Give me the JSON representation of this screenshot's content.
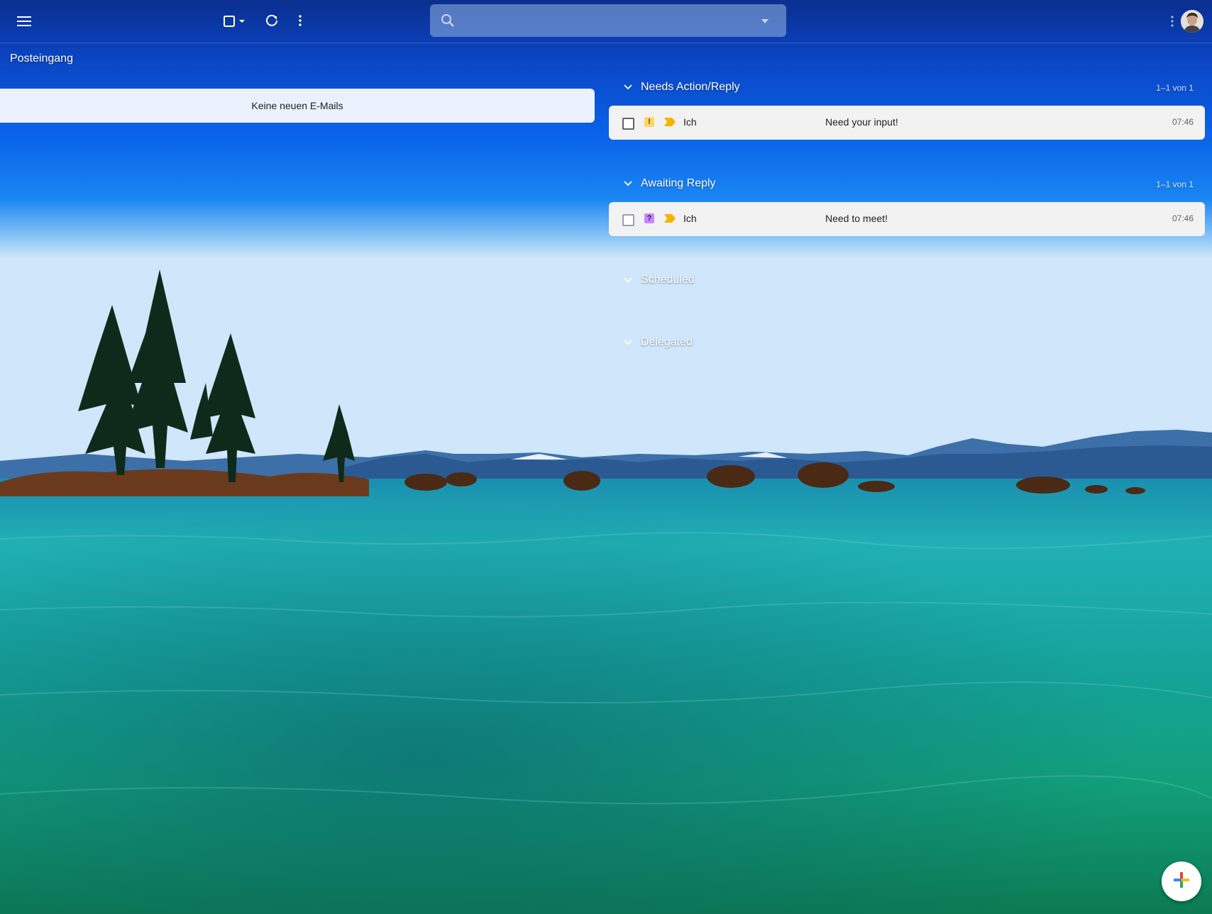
{
  "colors": {
    "accent_yellow": "#f4b400",
    "badge_action_bg": "#fdd663",
    "badge_question_bg": "#c58af9",
    "row_bg": "#f2f2f2"
  },
  "toolbar": {
    "menu_icon": "hamburger-menu-icon",
    "select_icon": "checkbox-select-icon",
    "refresh_icon": "refresh-icon",
    "more_icon": "more-vert-icon"
  },
  "search": {
    "value": "",
    "placeholder": "",
    "icon": "search-icon",
    "options_icon": "caret-down-icon"
  },
  "inbox": {
    "title": "Posteingang",
    "empty_message": "Keine neuen E-Mails"
  },
  "sections": [
    {
      "label": "Needs Action/Reply",
      "count": "1–1 von 1",
      "emails": [
        {
          "badge": "!",
          "sender": "Ich",
          "subject": "Need your input!",
          "time": "07:46"
        }
      ]
    },
    {
      "label": "Awaiting Reply",
      "count": "1–1 von 1",
      "emails": [
        {
          "badge": "?",
          "sender": "Ich",
          "subject": "Need to meet!",
          "time": "07:46"
        }
      ]
    },
    {
      "label": "Scheduled",
      "count": "",
      "emails": []
    },
    {
      "label": "Delegated",
      "count": "",
      "emails": []
    }
  ],
  "compose": {
    "icon": "plus-icon"
  }
}
